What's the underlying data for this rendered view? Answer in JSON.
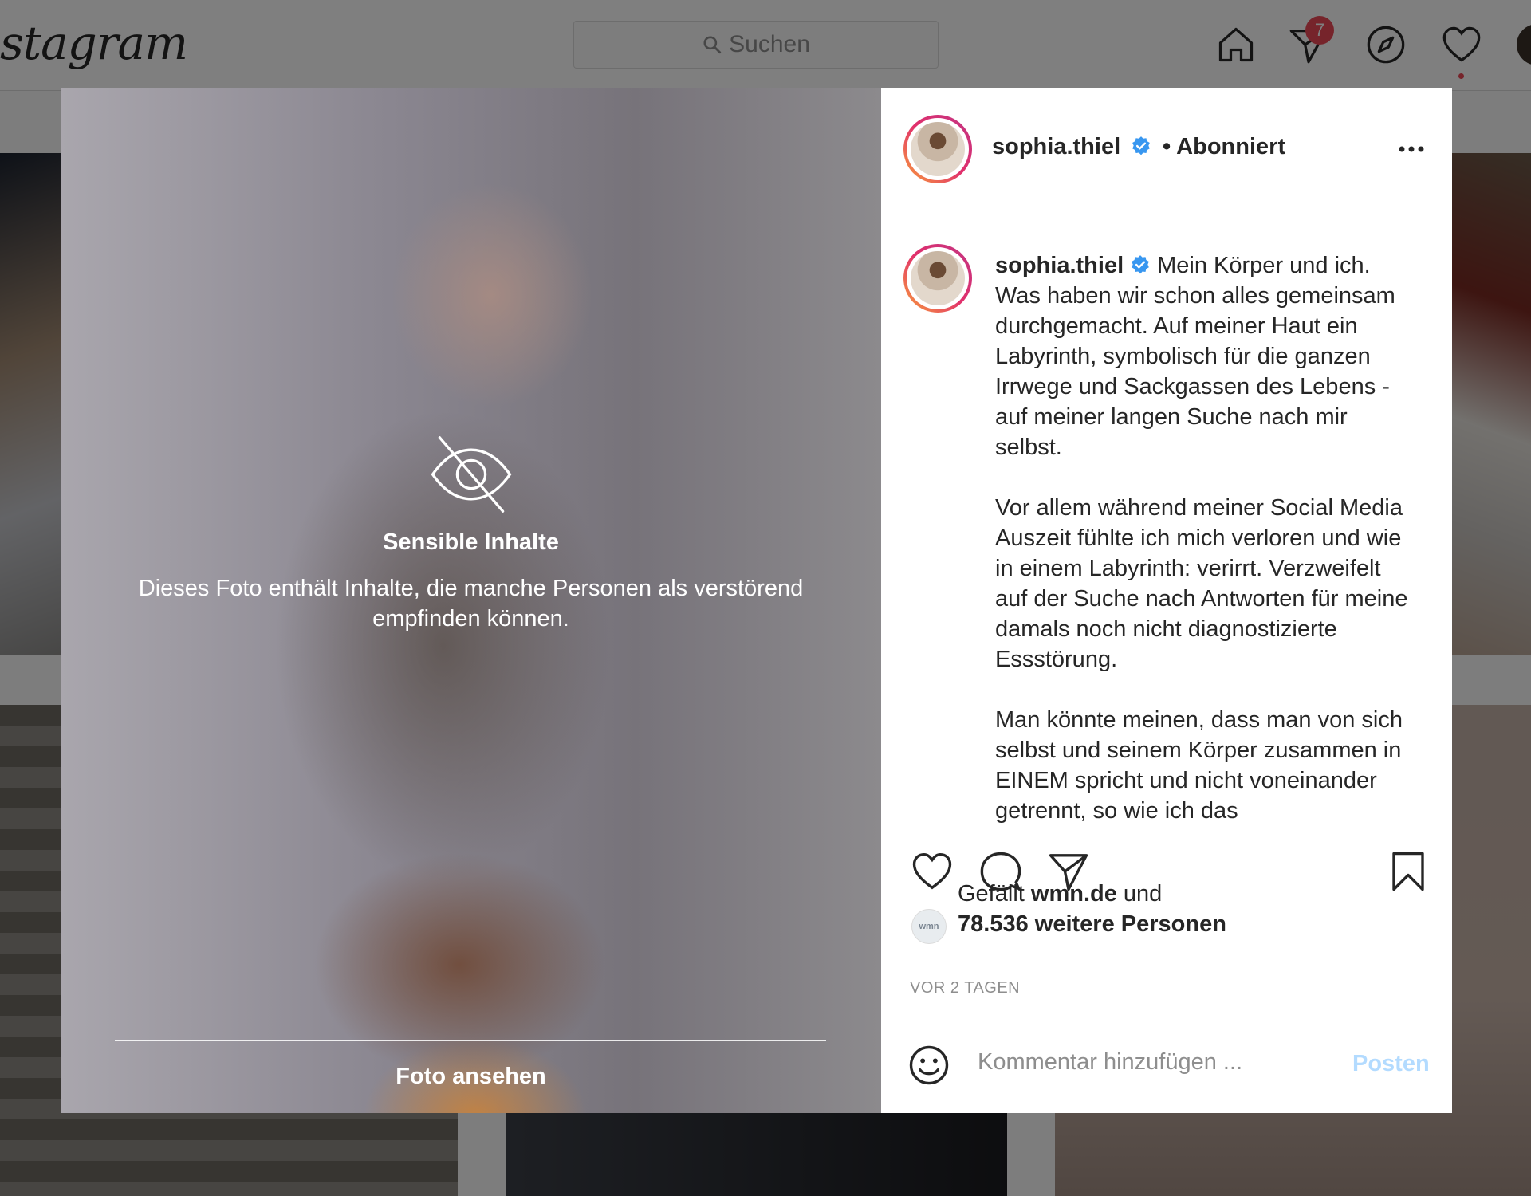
{
  "topbar": {
    "logo": "stagram",
    "search_placeholder": "Suchen",
    "direct_badge": "7"
  },
  "sensitive": {
    "title": "Sensible Inhalte",
    "description": "Dieses Foto enthält Inhalte, die manche Personen als verstörend empfinden können.",
    "show_button": "Foto ansehen"
  },
  "post": {
    "username": "sophia.thiel",
    "follow_status": "• Abonniert",
    "caption_lead": "Mein Körper und ich.",
    "caption_blocks": [
      "Was haben wir schon alles gemeinsam durchgemacht. Auf meiner Haut ein Labyrinth, symbolisch für die ganzen Irrwege und Sackgassen des Lebens - auf meiner langen Suche nach mir selbst.",
      "Vor allem während meiner Social Media Auszeit fühlte ich mich verloren und wie in einem Labyrinth: verirrt. Verzweifelt auf der Suche nach Antworten für meine damals noch nicht diagnostizierte Essstörung.",
      "Man könnte meinen, dass man von sich selbst und seinem Körper zusammen in EINEM spricht und nicht voneinander getrennt, so wie ich das"
    ],
    "likes_prefix": "Gefällt",
    "likes_user": "wmn.de",
    "likes_and": "und",
    "likes_others": "78.536 weitere Personen",
    "likes_avatar_text": "wmn",
    "timestamp": "VOR 2 TAGEN",
    "comment_placeholder": "Kommentar hinzufügen ...",
    "post_button": "Posten"
  },
  "colors": {
    "accent_blue": "#0095f6",
    "post_disabled": "#b3dbff",
    "badge_red": "#ed4956",
    "verified_blue": "#3897f0"
  },
  "icons": [
    "search-icon",
    "home-icon",
    "direct-icon",
    "explore-icon",
    "activity-heart-icon",
    "eye-slash-icon",
    "verified-icon",
    "more-icon",
    "like-icon",
    "comment-icon",
    "share-icon",
    "save-icon",
    "emoji-icon"
  ]
}
